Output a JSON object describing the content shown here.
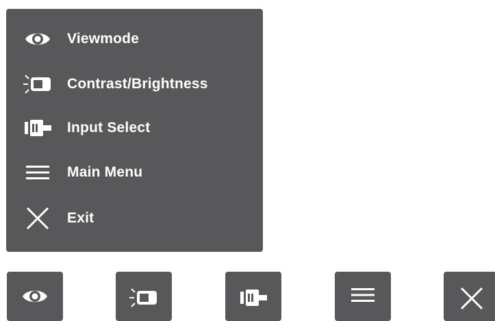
{
  "menu": {
    "items": [
      {
        "label": "Viewmode",
        "icon": "eye-icon"
      },
      {
        "label": "Contrast/Brightness",
        "icon": "contrast-brightness-icon"
      },
      {
        "label": "Input Select",
        "icon": "input-connector-icon"
      },
      {
        "label": "Main Menu",
        "icon": "menu-lines-icon"
      },
      {
        "label": "Exit",
        "icon": "close-x-icon"
      }
    ]
  },
  "hotkeys": [
    {
      "icon": "eye-icon"
    },
    {
      "icon": "contrast-brightness-icon"
    },
    {
      "icon": "input-connector-icon"
    },
    {
      "icon": "menu-lines-icon"
    },
    {
      "icon": "close-x-icon"
    }
  ],
  "colors": {
    "panel": "#58585a",
    "text": "#ffffff",
    "background": "#ffffff"
  }
}
